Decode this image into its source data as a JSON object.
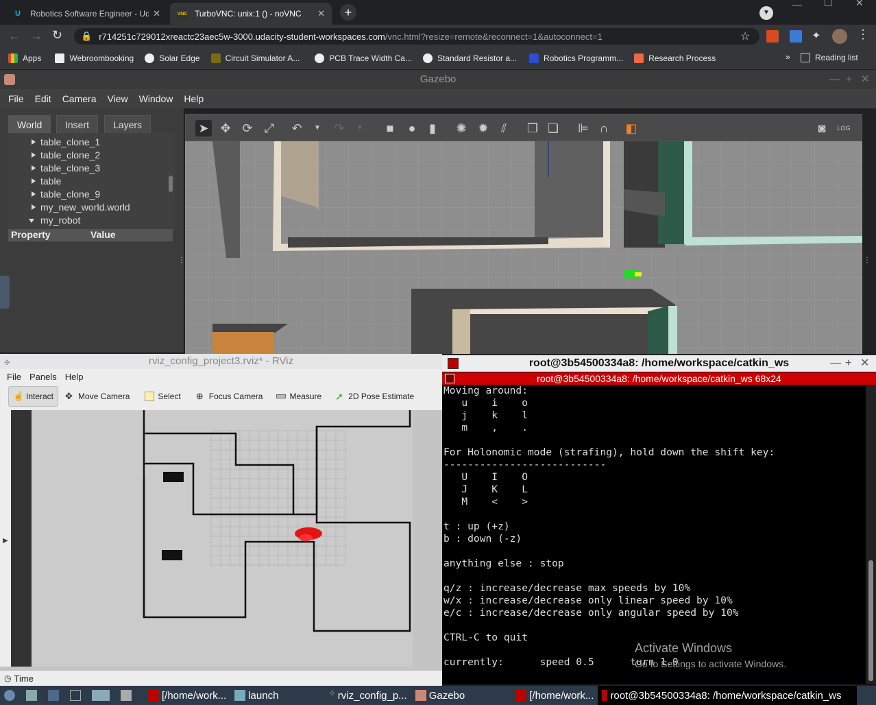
{
  "browser": {
    "tabs": [
      {
        "title": "Robotics Software Engineer - Uda",
        "icon": "udacity-icon"
      },
      {
        "title": "TurboVNC: unix:1 () - noVNC",
        "icon": "vnc-icon"
      }
    ],
    "url_host": "r714251c729012xreactc23aec5w-3000.udacity-student-workspaces.com",
    "url_path": "/vnc.html?resize=remote&reconnect=1&autoconnect=1",
    "bookmarks": [
      "Apps",
      "Webroombooking",
      "Solar Edge",
      "Circuit Simulator A...",
      "PCB Trace Width Ca...",
      "Standard Resistor a...",
      "Robotics Programm...",
      "Research Process"
    ],
    "more": "»",
    "reading_list": "Reading list"
  },
  "gazebo": {
    "title": "Gazebo",
    "menu": [
      "File",
      "Edit",
      "Camera",
      "View",
      "Window",
      "Help"
    ],
    "tabs": [
      "World",
      "Insert",
      "Layers"
    ],
    "tree": [
      "table_clone_1",
      "table_clone_2",
      "table_clone_3",
      "table",
      "table_clone_9",
      "my_new_world.world",
      "my_robot"
    ],
    "prop_headers": [
      "Property",
      "Value"
    ]
  },
  "rviz": {
    "title": "rviz_config_project3.rviz* - RViz",
    "menu": [
      "File",
      "Panels",
      "Help"
    ],
    "tools": [
      "Interact",
      "Move Camera",
      "Select",
      "Focus Camera",
      "Measure",
      "2D Pose Estimate"
    ],
    "time_label": "Time"
  },
  "terminal": {
    "title": "root@3b54500334a8: /home/workspace/catkin_ws",
    "header": "root@3b54500334a8: /home/workspace/catkin_ws 68x24",
    "lines": [
      "Moving around:",
      "   u    i    o",
      "   j    k    l",
      "   m    ,    .",
      "",
      "For Holonomic mode (strafing), hold down the shift key:",
      "---------------------------",
      "   U    I    O",
      "   J    K    L",
      "   M    <    >",
      "",
      "t : up (+z)",
      "b : down (-z)",
      "",
      "anything else : stop",
      "",
      "q/z : increase/decrease max speeds by 10%",
      "w/x : increase/decrease only linear speed by 10%",
      "e/c : increase/decrease only angular speed by 10%",
      "",
      "CTRL-C to quit",
      "",
      "currently:      speed 0.5      turn 1.0"
    ],
    "activate_title": "Activate Windows",
    "activate_sub": "Go to Settings to activate Windows."
  },
  "taskbar": {
    "items": [
      "[/home/work...",
      "launch",
      "rviz_config_p...",
      "Gazebo",
      "[/home/work...",
      "root@3b54500334a8: /home/workspace/catkin_ws"
    ]
  }
}
